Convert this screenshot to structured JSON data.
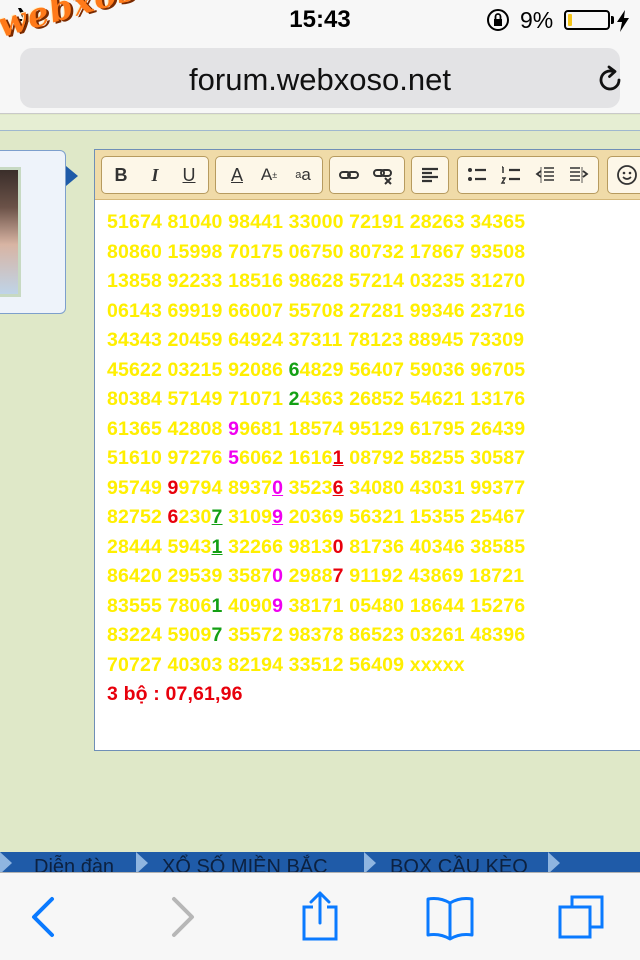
{
  "status_bar": {
    "time": "15:43",
    "battery_percent": "9%",
    "battery_level": 0.09,
    "icons": [
      "airplane-icon",
      "orientation-lock-icon",
      "battery-icon",
      "charging-bolt-icon"
    ]
  },
  "browser": {
    "url": "forum.webxoso.net",
    "logo": "webxoso.net",
    "reload_icon": "reload-icon",
    "toolbar_icons": [
      "back-arrow-icon",
      "forward-arrow-icon",
      "share-icon",
      "bookmarks-icon",
      "tabs-icon"
    ]
  },
  "editor": {
    "toolbar": {
      "bold": "B",
      "italic": "I",
      "underline": "U",
      "font_color": "A",
      "font_size": "A",
      "font_size_sup": "±",
      "subscript": "a",
      "subscript_sub": "a",
      "icons": [
        "link-icon",
        "unlink-icon",
        "align-left-icon",
        "bullet-list-icon",
        "numbered-list-icon",
        "outdent-icon",
        "indent-icon",
        "smiley-icon"
      ]
    },
    "text_color": "#ffef00",
    "lines": [
      [
        {
          "t": "51674 81040 98441 33000 72191 28263 34365"
        }
      ],
      [
        {
          "t": "80860 15998 70175 06750 80732 17867 93508"
        }
      ],
      [
        {
          "t": "13858 92233 18516 98628 57214 03235 31270"
        }
      ],
      [
        {
          "t": "06143 69919 66007 55708 27281 99346 23716"
        }
      ],
      [
        {
          "t": "34343 20459 64924 37311 78123 88945 73309"
        }
      ],
      [
        {
          "t": "45622 03215 92086 "
        },
        {
          "t": "6",
          "c": "green"
        },
        {
          "t": "4829 56407 59036 96705"
        }
      ],
      [
        {
          "t": "80384 57149 71071 "
        },
        {
          "t": "2",
          "c": "green"
        },
        {
          "t": "4363 26852 54621 13176"
        }
      ],
      [
        {
          "t": "61365 42808 "
        },
        {
          "t": "9",
          "c": "magenta"
        },
        {
          "t": "9681 18574 95129 61795 26439"
        }
      ],
      [
        {
          "t": "51610 97276 "
        },
        {
          "t": "5",
          "c": "magenta"
        },
        {
          "t": "6062 1616"
        },
        {
          "t": "1",
          "c": "red",
          "u": true
        },
        {
          "t": " 08792 58255 30587"
        }
      ],
      [
        {
          "t": "95749 "
        },
        {
          "t": "9",
          "c": "red"
        },
        {
          "t": "9794 8937"
        },
        {
          "t": "0",
          "c": "magenta",
          "u": true
        },
        {
          "t": " 3523"
        },
        {
          "t": "6",
          "c": "red",
          "u": true
        },
        {
          "t": " 34080 43031 99377"
        }
      ],
      [
        {
          "t": "82752 "
        },
        {
          "t": "6",
          "c": "red"
        },
        {
          "t": "230"
        },
        {
          "t": "7",
          "c": "green",
          "u": true
        },
        {
          "t": " 3109"
        },
        {
          "t": "9",
          "c": "magenta",
          "u": true
        },
        {
          "t": " 20369 56321 15355 25467"
        }
      ],
      [
        {
          "t": "28444 5943"
        },
        {
          "t": "1",
          "c": "green",
          "u": true
        },
        {
          "t": " 32266 9813"
        },
        {
          "t": "0",
          "c": "red"
        },
        {
          "t": " 81736 40346 38585"
        }
      ],
      [
        {
          "t": "86420 29539 3587"
        },
        {
          "t": "0",
          "c": "magenta"
        },
        {
          "t": " 2988"
        },
        {
          "t": "7",
          "c": "red"
        },
        {
          "t": " 91192 43869 18721"
        }
      ],
      [
        {
          "t": "83555 7806"
        },
        {
          "t": "1",
          "c": "green"
        },
        {
          "t": " 4090"
        },
        {
          "t": "9",
          "c": "magenta"
        },
        {
          "t": " 38171 05480 18644 15276"
        }
      ],
      [
        {
          "t": "83224 5909"
        },
        {
          "t": "7",
          "c": "green"
        },
        {
          "t": " 35572 98378 86523 03261 48396"
        }
      ],
      [
        {
          "t": "70727 40303 82194 33512 56409 xxxxx"
        }
      ]
    ],
    "summary": "3 bộ : 07,61,96"
  },
  "forum_nav": {
    "tabs": [
      "Diễn đàn",
      "XỔ SỐ MIỀN BẮC",
      "BOX CẦU KÈO"
    ]
  }
}
